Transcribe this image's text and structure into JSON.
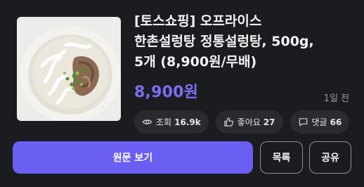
{
  "post": {
    "title_lines": [
      "[토스쇼핑] 오프라이스",
      "한촌설렁탕 정통설렁탕, 500g,",
      "5개 (8,900원/무배)"
    ],
    "price": "8,900원",
    "time_ago": "1일 전"
  },
  "stats": {
    "views": {
      "icon": "eye-icon",
      "label": "조회",
      "value": "16.9k"
    },
    "likes": {
      "icon": "thumbs-up-icon",
      "label": "좋아요",
      "value": "27"
    },
    "comments": {
      "icon": "comment-icon",
      "label": "댓글",
      "value": "66"
    }
  },
  "actions": {
    "view_original": "원문 보기",
    "list": "목록",
    "share": "공유"
  },
  "colors": {
    "background": "#1b1c20",
    "accent": "#7c6df4",
    "primary_button": "#6a5ef3",
    "chip_background": "#2a2b31"
  }
}
